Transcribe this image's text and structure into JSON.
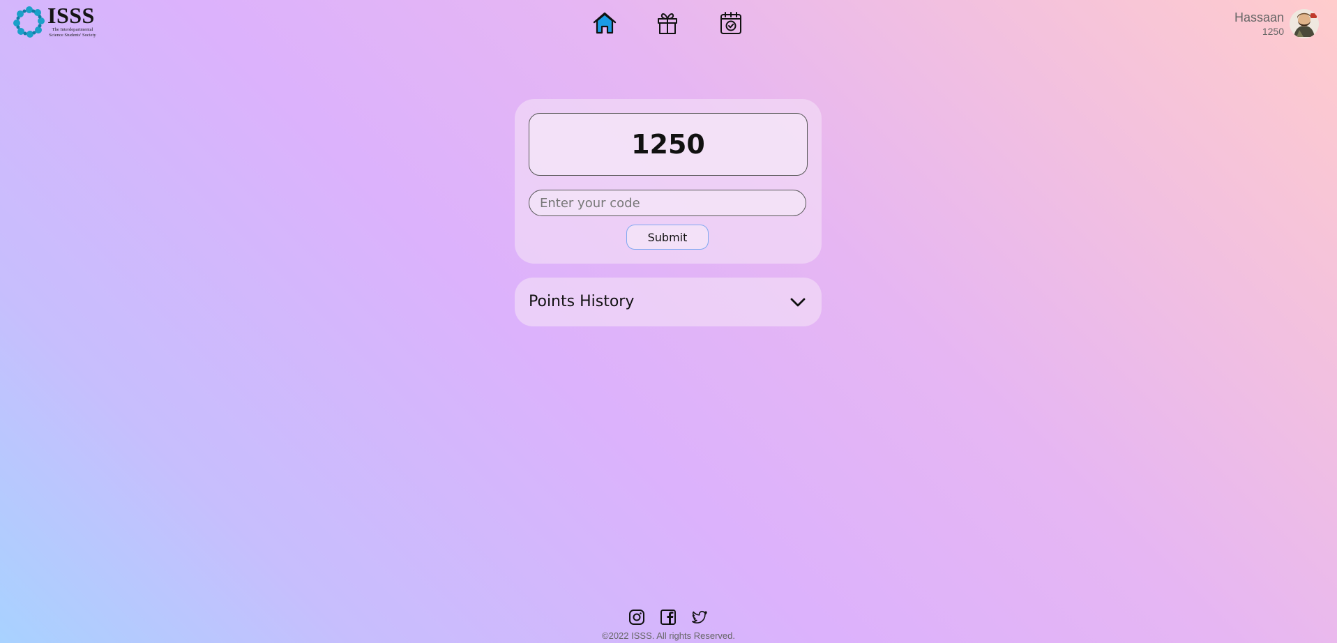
{
  "header": {
    "logo": {
      "title": "ISSS",
      "tagline": "The Interdepartmental Science Students' Society"
    },
    "nav": [
      {
        "name": "home",
        "icon": "home-icon",
        "active": true
      },
      {
        "name": "rewards",
        "icon": "gift-icon",
        "active": false
      },
      {
        "name": "events",
        "icon": "calendar-check-icon",
        "active": false
      }
    ],
    "user": {
      "name": "Hassaan",
      "points": "1250"
    }
  },
  "points_card": {
    "balance": "1250",
    "code_input": {
      "value": "",
      "placeholder": "Enter your code"
    },
    "submit_label": "Submit"
  },
  "history": {
    "title": "Points History",
    "icon": "chevron-down-icon"
  },
  "footer": {
    "social": [
      "instagram-icon",
      "facebook-icon",
      "twitter-icon"
    ],
    "copyright": "©2022 ISSS. All rights Reserved."
  },
  "colors": {
    "gradient": [
      "#a8d2ff",
      "#dcb2fc",
      "#ffcccc"
    ],
    "active_icon": "#1a9be6",
    "submit_border": "#7fa8f0"
  }
}
